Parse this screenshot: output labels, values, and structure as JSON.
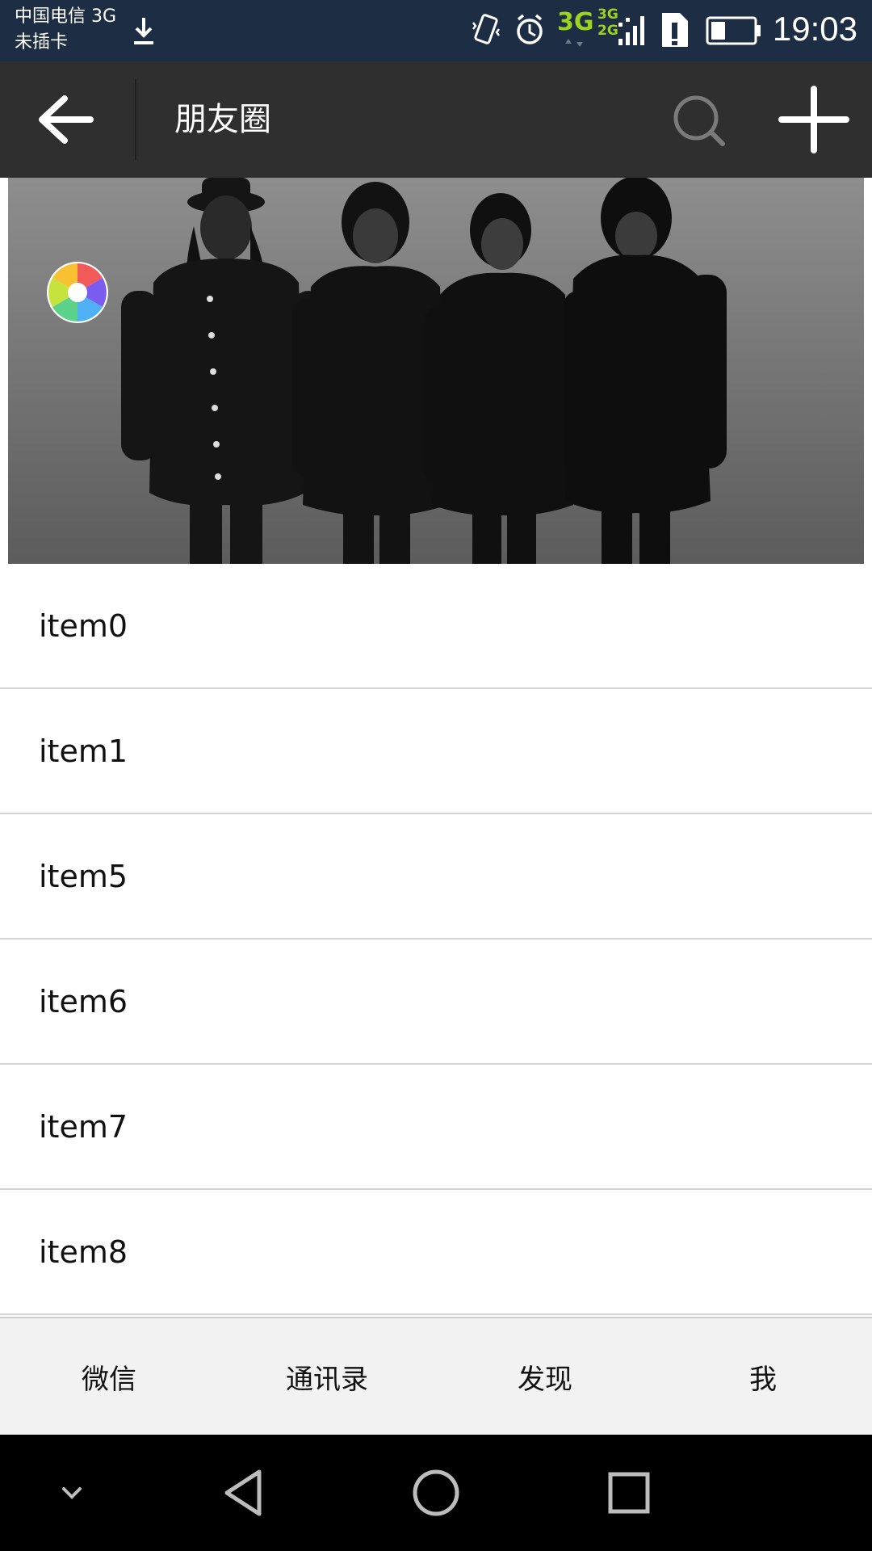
{
  "status_bar": {
    "carrier_line1": "中国电信 3G",
    "carrier_line2": "未插卡",
    "network_primary": "3G",
    "network_secondary_top": "3G",
    "network_secondary_bottom": "2G",
    "time": "19:03",
    "icons": [
      "download-icon",
      "vibrate-icon",
      "alarm-icon",
      "signal-icon",
      "sim-alert-icon",
      "battery-icon"
    ]
  },
  "action_bar": {
    "title": "朋友圈",
    "icons": [
      "back-arrow-icon",
      "search-icon",
      "plus-icon"
    ]
  },
  "header": {
    "image": "band-photo",
    "icon": "aperture-icon"
  },
  "list": {
    "items": [
      {
        "label": "item0"
      },
      {
        "label": "item1"
      },
      {
        "label": "item5"
      },
      {
        "label": "item6"
      },
      {
        "label": "item7"
      },
      {
        "label": "item8"
      }
    ]
  },
  "tabs": [
    {
      "label": "微信"
    },
    {
      "label": "通讯录"
    },
    {
      "label": "发现"
    },
    {
      "label": "我"
    }
  ],
  "nav_bar": {
    "icons": [
      "collapse-icon",
      "nav-back-icon",
      "nav-home-icon",
      "nav-recents-icon"
    ]
  },
  "colors": {
    "status_bar_bg": "#1d2d44",
    "action_bar_bg": "#2f2f2f",
    "network_accent": "#9bd31f",
    "tab_bar_bg": "#f2f2f2",
    "nav_bar_bg": "#000000"
  }
}
